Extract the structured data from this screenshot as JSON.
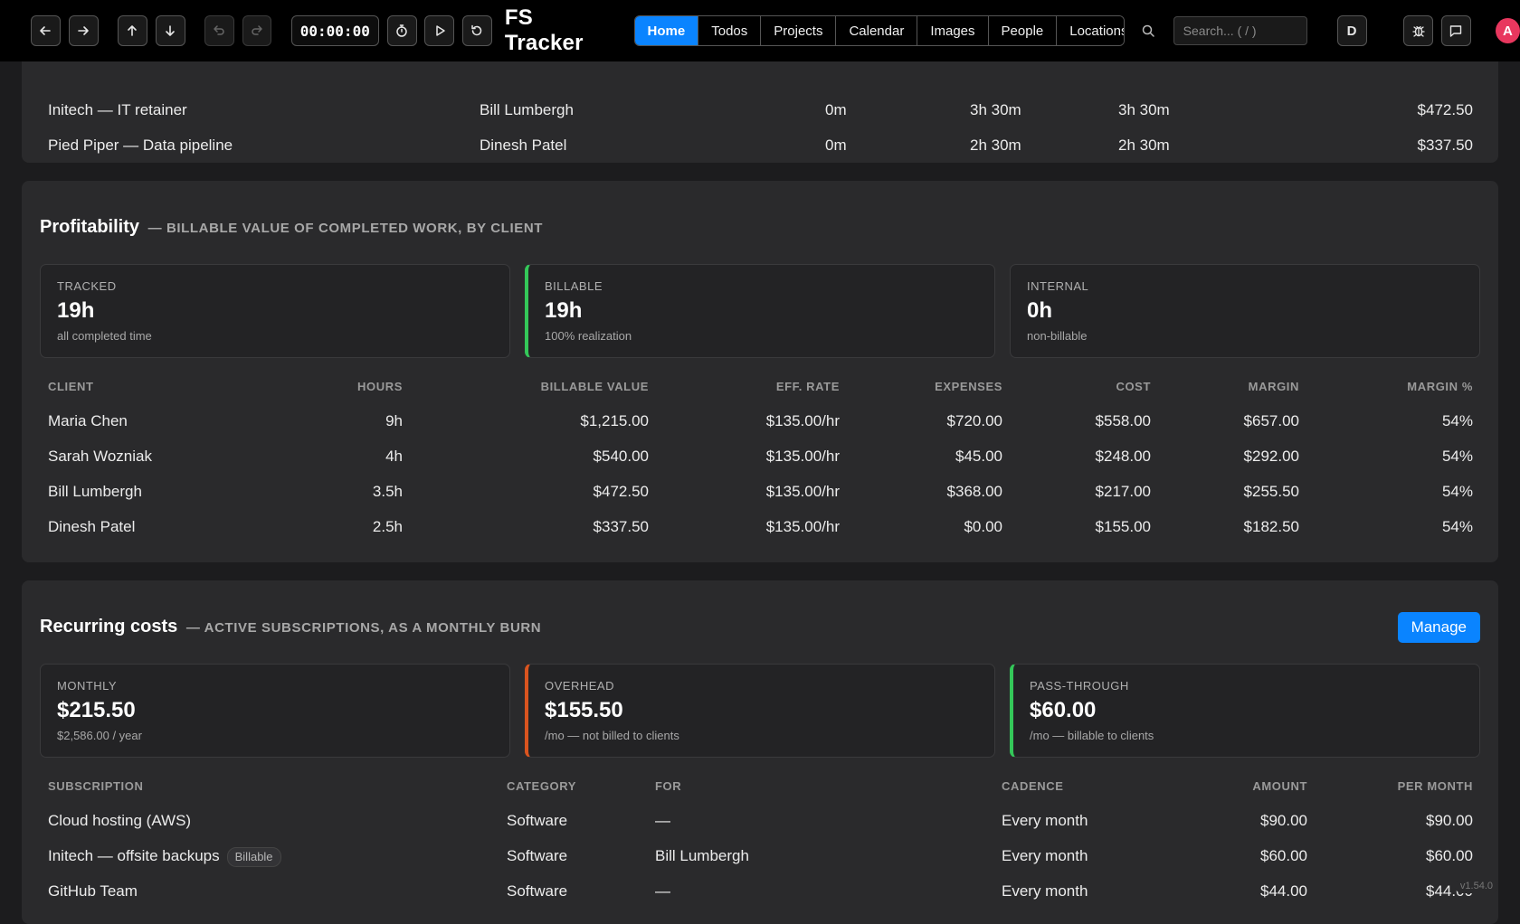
{
  "app": {
    "title": "FS Tracker"
  },
  "toolbar": {
    "timer": "00:00:00",
    "icons": [
      "arrow-left-icon",
      "arrow-right-icon",
      "arrow-up-icon",
      "arrow-down-icon",
      "undo-icon",
      "redo-icon",
      "stopwatch-icon",
      "play-icon",
      "reset-icon"
    ],
    "d_label": "D",
    "avatar_initial": "A"
  },
  "nav": {
    "tabs": [
      {
        "label": "Home",
        "active": true
      },
      {
        "label": "Todos"
      },
      {
        "label": "Projects"
      },
      {
        "label": "Calendar"
      },
      {
        "label": "Images"
      },
      {
        "label": "People"
      },
      {
        "label": "Locations"
      }
    ]
  },
  "search": {
    "placeholder": "Search... ( / )"
  },
  "project_table": {
    "rows": [
      {
        "project": "Initech — IT retainer",
        "client": "Bill Lumbergh",
        "c3": "0m",
        "c4": "3h 30m",
        "c5": "3h 30m",
        "value": "$472.50"
      },
      {
        "project": "Pied Piper — Data pipeline",
        "client": "Dinesh Patel",
        "c3": "0m",
        "c4": "2h 30m",
        "c5": "2h 30m",
        "value": "$337.50"
      }
    ]
  },
  "profitability": {
    "title": "Profitability",
    "subtitle": "— BILLABLE VALUE OF COMPLETED WORK, BY CLIENT",
    "stats": [
      {
        "label": "TRACKED",
        "value": "19h",
        "note": "all completed time"
      },
      {
        "label": "BILLABLE",
        "value": "19h",
        "note": "100% realization"
      },
      {
        "label": "INTERNAL",
        "value": "0h",
        "note": "non-billable"
      }
    ],
    "headers": [
      "CLIENT",
      "HOURS",
      "BILLABLE VALUE",
      "EFF. RATE",
      "EXPENSES",
      "COST",
      "MARGIN",
      "MARGIN %"
    ],
    "rows": [
      {
        "client": "Maria Chen",
        "hours": "9h",
        "value": "$1,215.00",
        "rate": "$135.00/hr",
        "expenses": "$720.00",
        "cost": "$558.00",
        "margin": "$657.00",
        "pct": "54%"
      },
      {
        "client": "Sarah Wozniak",
        "hours": "4h",
        "value": "$540.00",
        "rate": "$135.00/hr",
        "expenses": "$45.00",
        "cost": "$248.00",
        "margin": "$292.00",
        "pct": "54%"
      },
      {
        "client": "Bill Lumbergh",
        "hours": "3.5h",
        "value": "$472.50",
        "rate": "$135.00/hr",
        "expenses": "$368.00",
        "cost": "$217.00",
        "margin": "$255.50",
        "pct": "54%"
      },
      {
        "client": "Dinesh Patel",
        "hours": "2.5h",
        "value": "$337.50",
        "rate": "$135.00/hr",
        "expenses": "$0.00",
        "cost": "$155.00",
        "margin": "$182.50",
        "pct": "54%"
      }
    ]
  },
  "recurring": {
    "title": "Recurring costs",
    "subtitle": "— ACTIVE SUBSCRIPTIONS, AS A MONTHLY BURN",
    "manage_label": "Manage",
    "stats": [
      {
        "label": "MONTHLY",
        "value": "$215.50",
        "note": "$2,586.00 / year"
      },
      {
        "label": "OVERHEAD",
        "value": "$155.50",
        "note": "/mo — not billed to clients"
      },
      {
        "label": "PASS-THROUGH",
        "value": "$60.00",
        "note": "/mo — billable to clients"
      }
    ],
    "headers": [
      "SUBSCRIPTION",
      "CATEGORY",
      "FOR",
      "CADENCE",
      "AMOUNT",
      "PER MONTH"
    ],
    "rows": [
      {
        "name": "Cloud hosting (AWS)",
        "tag": "",
        "category": "Software",
        "for": "—",
        "cadence": "Every month",
        "amount": "$90.00",
        "per_month": "$90.00"
      },
      {
        "name": "Initech — offsite backups",
        "tag": "Billable",
        "category": "Software",
        "for": "Bill Lumbergh",
        "cadence": "Every month",
        "amount": "$60.00",
        "per_month": "$60.00"
      },
      {
        "name": "GitHub Team",
        "tag": "",
        "category": "Software",
        "for": "—",
        "cadence": "Every month",
        "amount": "$44.00",
        "per_month": "$44.00"
      }
    ]
  },
  "version": "v1.54.0"
}
